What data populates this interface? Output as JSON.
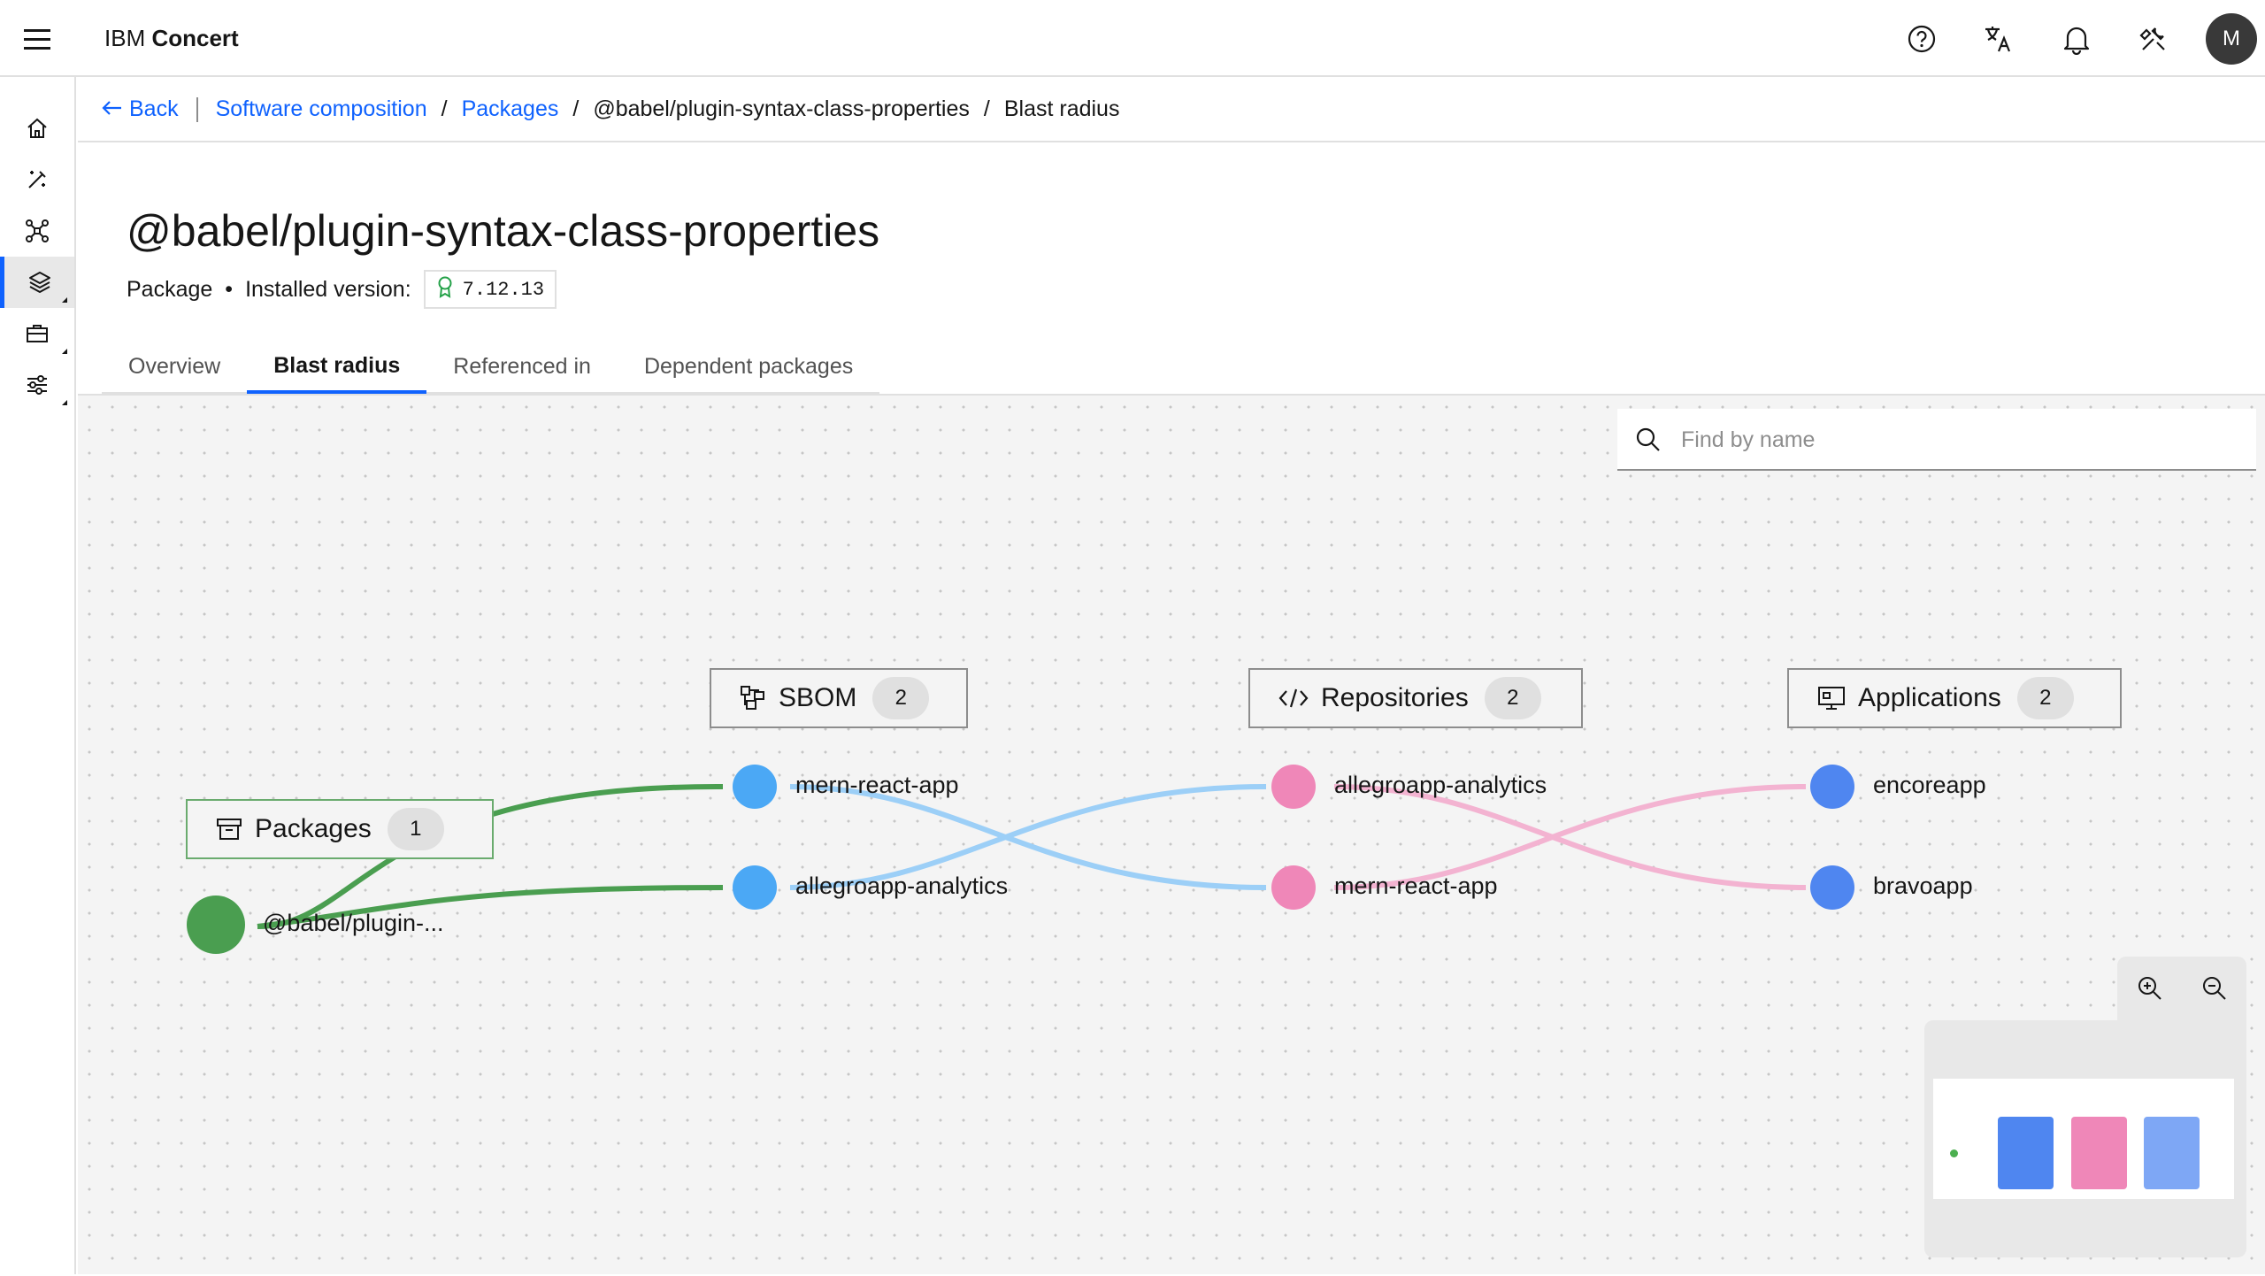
{
  "header": {
    "brand_prefix": "IBM",
    "brand_name": "Concert",
    "avatar_initial": "M"
  },
  "breadcrumb": {
    "back": "Back",
    "items": [
      "Software composition",
      "Packages",
      "@babel/plugin-syntax-class-properties",
      "Blast radius"
    ]
  },
  "page": {
    "title": "@babel/plugin-syntax-class-properties",
    "type": "Package",
    "version_label": "Installed version:",
    "version": "7.12.13"
  },
  "tabs": [
    {
      "label": "Overview",
      "active": false
    },
    {
      "label": "Blast radius",
      "active": true
    },
    {
      "label": "Referenced in",
      "active": false
    },
    {
      "label": "Dependent packages",
      "active": false
    }
  ],
  "search": {
    "placeholder": "Find by name"
  },
  "graph": {
    "groups": [
      {
        "label": "Packages",
        "count": "1",
        "icon": "archive-icon"
      },
      {
        "label": "SBOM",
        "count": "2",
        "icon": "sbom-icon"
      },
      {
        "label": "Repositories",
        "count": "2",
        "icon": "code-icon"
      },
      {
        "label": "Applications",
        "count": "2",
        "icon": "application-icon"
      }
    ],
    "nodes": {
      "package": "@babel/plugin-...",
      "sbom": [
        "mern-react-app",
        "allegroapp-analytics"
      ],
      "repositories": [
        "allegroapp-analytics",
        "mern-react-app"
      ],
      "applications": [
        "encoreapp",
        "bravoapp"
      ]
    },
    "colors": {
      "package": "#4a9e50",
      "sbom": "#4ba8f5",
      "repository": "#ef87b8",
      "application": "#4f86f0",
      "sbom_edge": "#9ccff7",
      "repo_edge": "#f3b3d1",
      "package_edge": "#4a9e50"
    }
  },
  "minimap": {
    "colors": [
      "#4f86f0",
      "#ef87b8",
      "#7ea7f5"
    ]
  }
}
